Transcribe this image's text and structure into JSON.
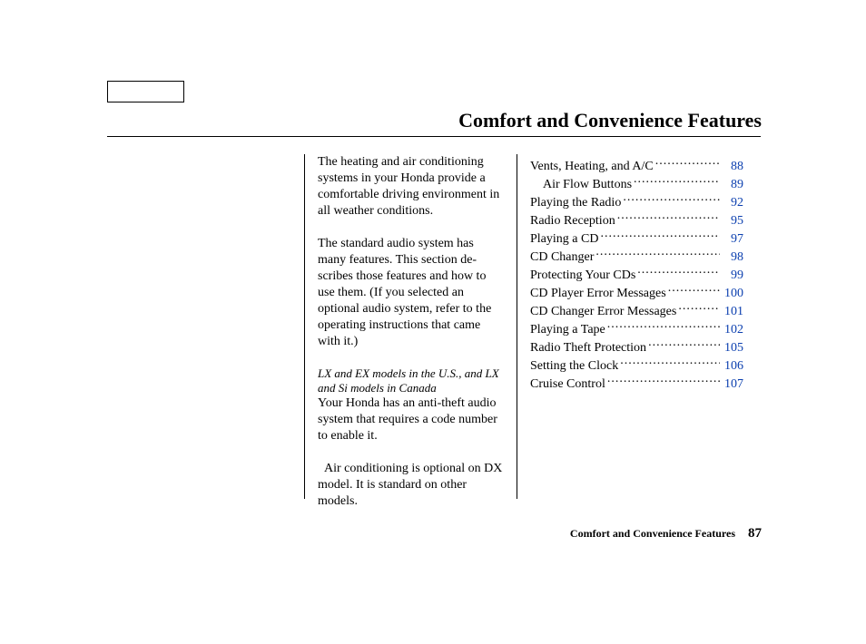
{
  "header": {
    "title": "Comfort and Convenience Features"
  },
  "body": {
    "para1": "The heating and air conditioning systems in your Honda provide a comfortable driving environment in all weather conditions.",
    "para2": "The standard audio system has many features. This section de­scribes those features and how to use them. (If you selected an optional audio system, refer to the operating instructions that came with it.)",
    "models_note": "LX and EX models in the U.S., and LX and Si models in Canada",
    "para3": "Your Honda has an anti-theft audio system that requires a code number to enable it.",
    "para4": " Air conditioning is optional on DX model. It is standard on other models."
  },
  "toc": [
    {
      "label": "Vents, Heating, and A/C",
      "page": "88",
      "sub": false
    },
    {
      "label": "Air Flow Buttons",
      "page": "89",
      "sub": true
    },
    {
      "label": "Playing the Radio",
      "page": "92",
      "sub": false
    },
    {
      "label": "Radio Reception",
      "page": "95",
      "sub": false
    },
    {
      "label": "Playing a CD",
      "page": "97",
      "sub": false
    },
    {
      "label": "CD Changer",
      "page": "98",
      "sub": false
    },
    {
      "label": "Protecting Your CDs",
      "page": "99",
      "sub": false
    },
    {
      "label": "CD Player Error Messages",
      "page": "100",
      "sub": false
    },
    {
      "label": "CD Changer Error Messages",
      "page": "101",
      "sub": false
    },
    {
      "label": "Playing a Tape",
      "page": "102",
      "sub": false
    },
    {
      "label": "Radio Theft Protection",
      "page": "105",
      "sub": false
    },
    {
      "label": "Setting the Clock",
      "page": "106",
      "sub": false
    },
    {
      "label": "Cruise Control",
      "page": "107",
      "sub": false
    }
  ],
  "footer": {
    "section": "Comfort and Convenience Features",
    "page": "87"
  }
}
